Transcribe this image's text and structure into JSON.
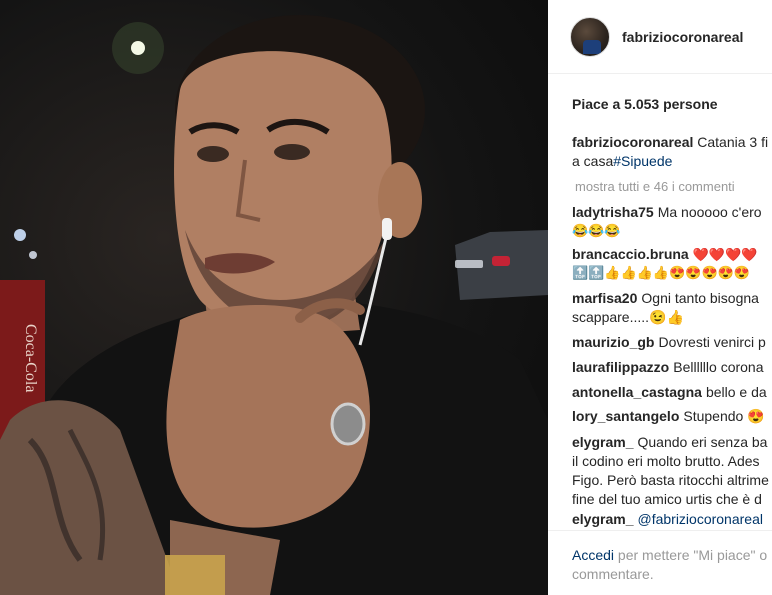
{
  "post": {
    "username": "fabriziocoronareal",
    "likes_text": "Piace a 5.053 persone",
    "caption": {
      "user": "fabriziocoronareal",
      "text": "Catania 3 fi",
      "text_line2": "a casa",
      "hashtag": "#Sipuede"
    },
    "show_all_comments": "mostra tutti e 46 i commenti",
    "comments": [
      {
        "user": "ladytrisha75",
        "text": "Ma nooooo c'ero",
        "emoji": "😂😂😂"
      },
      {
        "user": "brancaccio.bruna",
        "text": "",
        "emoji": "❤️❤️❤️❤️",
        "emoji_line2": "🔝🔝👍👍👍👍😍😍😍😍😍"
      },
      {
        "user": "marfisa20",
        "text": "Ogni tanto bisogna",
        "text_line2": "scappare.....😉👍"
      },
      {
        "user": "maurizio_gb",
        "text": "Dovresti venirci p"
      },
      {
        "user": "laurafilippazzo",
        "text": "Bellllllo corona"
      },
      {
        "user": "antonella_castagna",
        "text": "bello e da"
      },
      {
        "user": "lory_santangelo",
        "text": "Stupendo 😍"
      },
      {
        "user": "elygram_",
        "text": "Quando eri senza ba",
        "lines": [
          "il codino eri molto brutto. Ades",
          "Figo. Però basta ritocchi altrime",
          "fine del tuo amico urtis che è d"
        ]
      },
      {
        "user": "elygram_",
        "text": "@fabriziocoronareal"
      }
    ],
    "footer": {
      "login_link": "Accedi",
      "text": "per mettere \"Mi piace\" o",
      "text_line2": "commentare."
    }
  },
  "colors": {
    "link": "#003569",
    "muted": "#999999",
    "text": "#262626",
    "border": "#efefef"
  },
  "icons": {
    "avatar": "profile-avatar"
  }
}
